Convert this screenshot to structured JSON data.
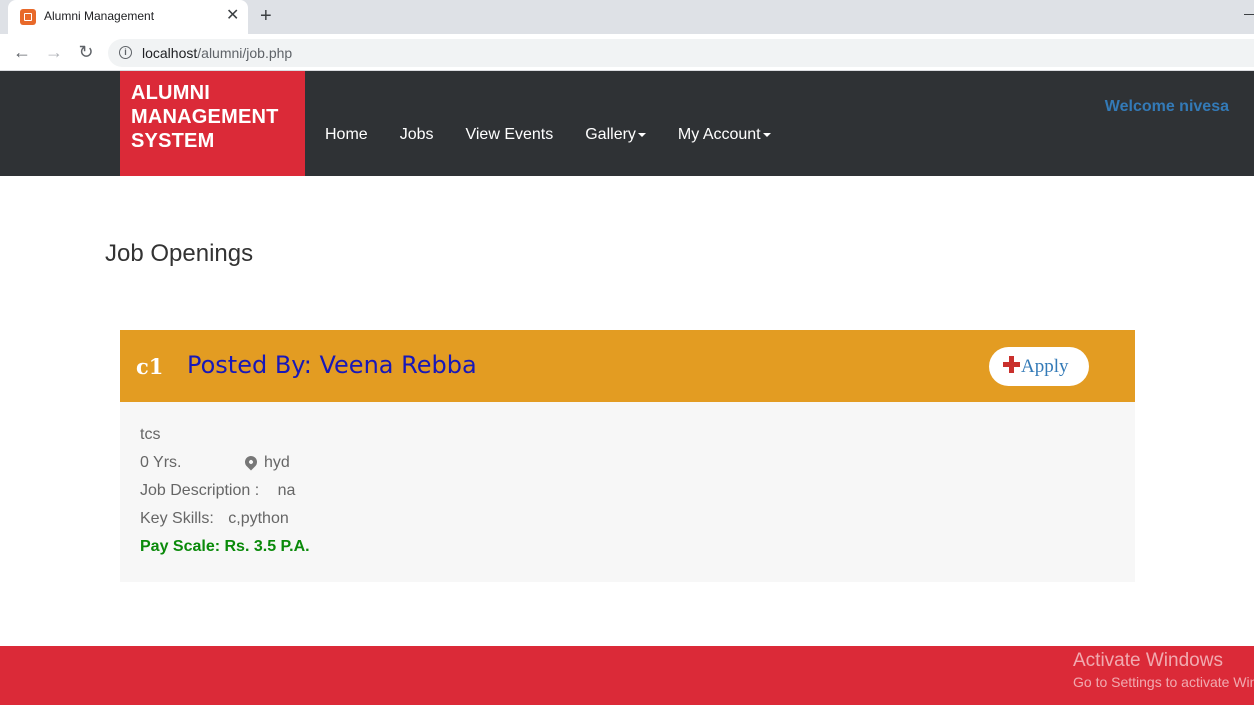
{
  "browser": {
    "tab_title": "Alumni Management",
    "tab_close": "✕",
    "new_tab": "+",
    "url_host": "localhost",
    "url_path": "/alumni/job.php",
    "back": "←",
    "forward": "→",
    "reload": "↻",
    "info": "i"
  },
  "navbar": {
    "brand": "ALUMNI MANAGEMENT SYSTEM",
    "items": [
      {
        "label": "Home"
      },
      {
        "label": "Jobs"
      },
      {
        "label": "View Events"
      },
      {
        "label": "Gallery",
        "dropdown": true
      },
      {
        "label": "My Account",
        "dropdown": true
      }
    ],
    "welcome": "Welcome nivesa"
  },
  "main": {
    "title": "Job Openings",
    "job": {
      "code": "c1",
      "posted_by": "Posted By: Veena Rebba",
      "apply_label": "Apply",
      "company": "tcs",
      "experience": "0 Yrs.",
      "location": "hyd",
      "description_label": "Job Description :",
      "description": "na",
      "skills_label": "Key Skills:",
      "skills": "c,python",
      "pay_scale": "Pay Scale: Rs. 3.5 P.A."
    }
  },
  "overlay": {
    "activate_title": "Activate Windows",
    "activate_sub": "Go to Settings to activate Windows."
  },
  "colors": {
    "brand_red": "#db2a38",
    "navbar_dark": "#2f3235",
    "job_header": "#e39c22",
    "posted_by": "#1818b8",
    "pay_green": "#0a8a0a",
    "welcome_blue": "#337ab7"
  }
}
